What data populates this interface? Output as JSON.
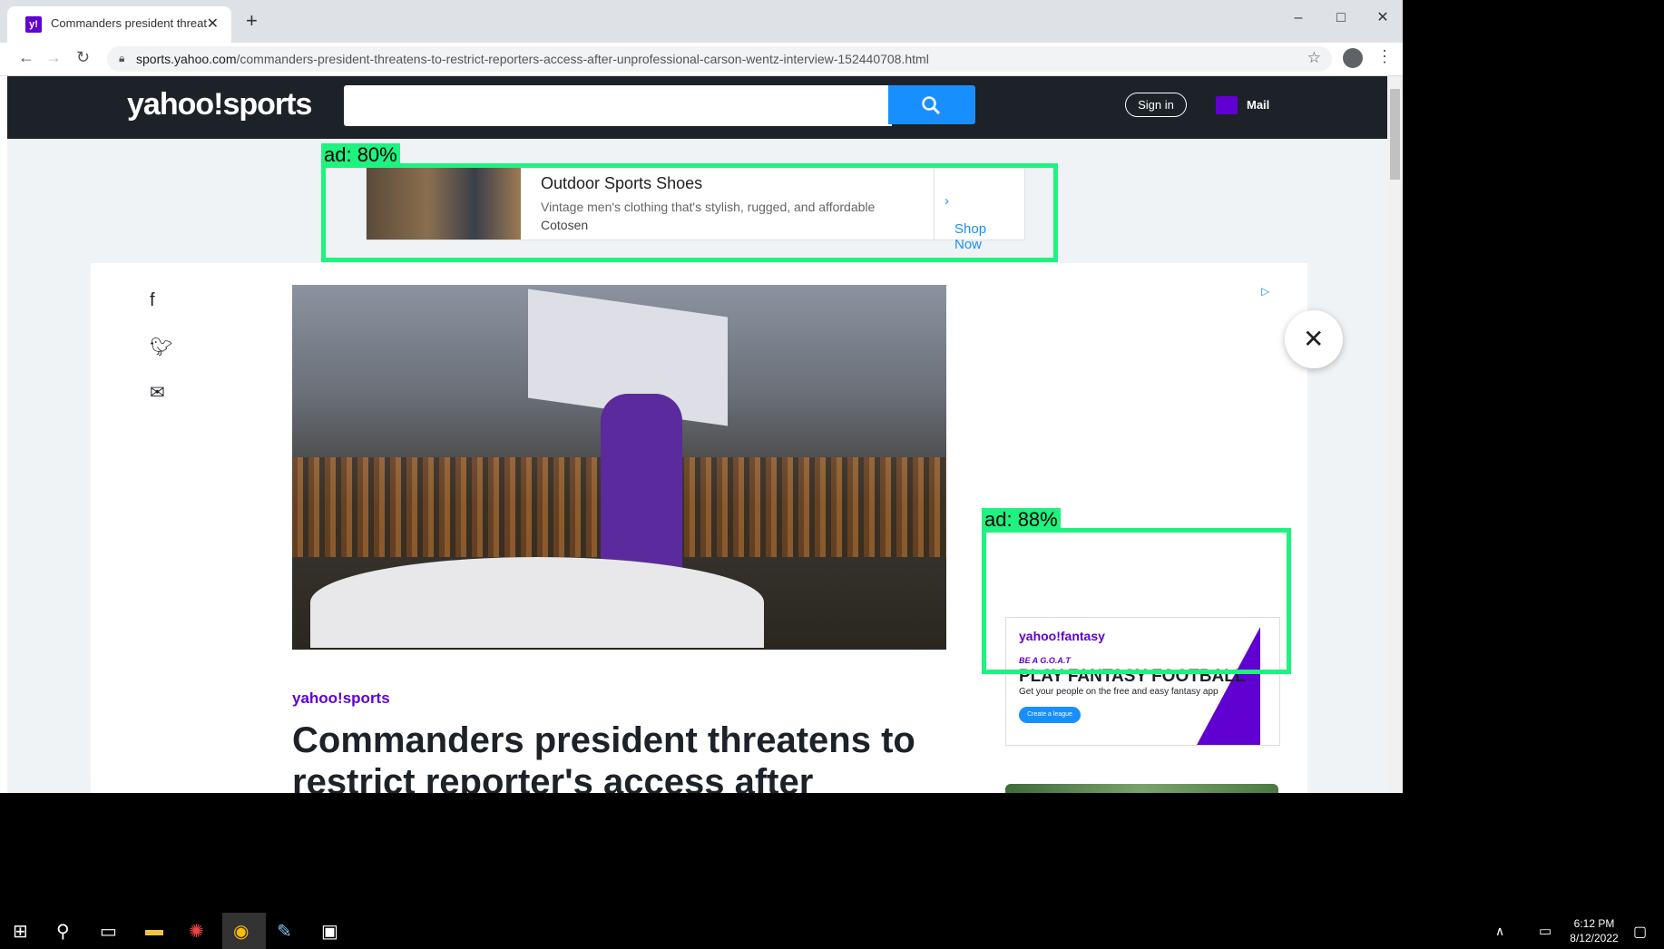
{
  "browser": {
    "tab_title": "Commanders president threaten",
    "favicon": "y!",
    "url_domain": "sports.yahoo.com",
    "url_path": "/commanders-president-threatens-to-restrict-reporters-access-after-unprofessional-carson-wentz-interview-152440708.html",
    "new_tab": "+",
    "minimize": "–",
    "maximize": "□",
    "close": "✕"
  },
  "header": {
    "logo": "yahoo!sports",
    "search_placeholder": "",
    "sign_in": "Sign in",
    "mail": "Mail"
  },
  "top_ad": {
    "overlay_label": "ad: 80%",
    "headline": "Outdoor Sports Shoes",
    "description": "Vintage men's clothing that's stylish, rugged, and affordable",
    "sponsor": "Cotosen",
    "cta": "Shop Now"
  },
  "side_ad": {
    "overlay_label": "ad: 88%",
    "brand": "yahoo!fantasy",
    "tagline": "BE A G.O.A.T",
    "headline": "PLAY FANTASY FOOTBALL",
    "subhead": "Get your people on the free and easy fantasy app",
    "button": "Create a league"
  },
  "article": {
    "source": "yahoo!sports",
    "headline": "Commanders president threatens to restrict reporter's access after"
  },
  "taskbar": {
    "time": "6:12 PM",
    "date": "8/12/2022"
  },
  "colors": {
    "header_bg": "#1d2228",
    "accent": "#6001d2",
    "search_button": "#188fff",
    "ad_detector": "#1ef27f"
  }
}
